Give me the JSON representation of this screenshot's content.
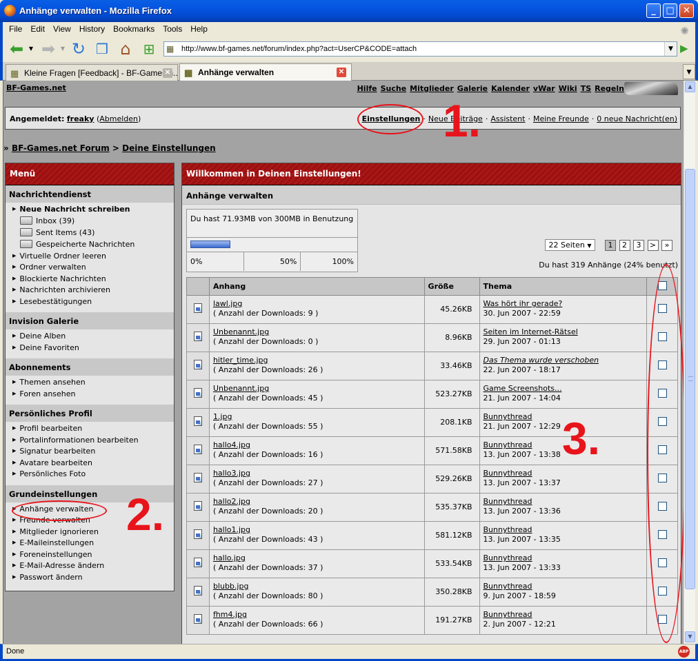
{
  "window": {
    "title": "Anhänge verwalten - Mozilla Firefox",
    "minimize": "_",
    "maximize": "□",
    "close": "✕"
  },
  "menubar": [
    "File",
    "Edit",
    "View",
    "History",
    "Bookmarks",
    "Tools",
    "Help"
  ],
  "navbar": {
    "url": "http://www.bf-games.net/forum/index.php?act=UserCP&CODE=attach"
  },
  "tabs": [
    {
      "label": "Kleine Fragen [Feedback] - BF-Games.n...",
      "active": false
    },
    {
      "label": "Anhänge verwalten",
      "active": true
    }
  ],
  "status": {
    "text": "Done",
    "abp": "ABP"
  },
  "forum": {
    "site_title": "BF-Games.net",
    "top_links": [
      "Hilfe",
      "Suche",
      "Mitglieder",
      "Galerie",
      "Kalender",
      "vWar",
      "Wiki",
      "TS",
      "Regeln"
    ],
    "user": {
      "logged_in_label": "Angemeldet:",
      "username": "freaky",
      "logout": "Abmelden"
    },
    "user_links": [
      "Einstellungen",
      "Neue Beiträge",
      "Assistent",
      "Meine Freunde",
      "0 neue Nachricht(en)"
    ],
    "breadcrumb": {
      "prefix": "»",
      "home": "BF-Games.net Forum",
      "sep": ">",
      "current": "Deine Einstellungen"
    }
  },
  "sidemenu": {
    "title": "Menü",
    "sections": [
      {
        "title": "Nachrichtendienst",
        "items": [
          {
            "label": "Neue Nachricht schreiben",
            "bold": true
          },
          {
            "label": "Inbox (39)",
            "folder": true
          },
          {
            "label": "Sent Items (43)",
            "folder": true
          },
          {
            "label": "Gespeicherte Nachrichten",
            "folder": true
          },
          {
            "label": "Virtuelle Ordner leeren"
          },
          {
            "label": "Ordner verwalten"
          },
          {
            "label": "Blockierte Nachrichten"
          },
          {
            "label": "Nachrichten archivieren"
          },
          {
            "label": "Lesebestätigungen"
          }
        ]
      },
      {
        "title": "Invision Galerie",
        "items": [
          {
            "label": "Deine Alben"
          },
          {
            "label": "Deine Favoriten"
          }
        ]
      },
      {
        "title": "Abonnements",
        "items": [
          {
            "label": "Themen ansehen"
          },
          {
            "label": "Foren ansehen"
          }
        ]
      },
      {
        "title": "Persönliches Profil",
        "items": [
          {
            "label": "Profil bearbeiten"
          },
          {
            "label": "Portalinformationen bearbeiten"
          },
          {
            "label": "Signatur bearbeiten"
          },
          {
            "label": "Avatare bearbeiten"
          },
          {
            "label": "Persönliches Foto"
          }
        ]
      },
      {
        "title": "Grundeinstellungen",
        "items": [
          {
            "label": "Anhänge verwalten"
          },
          {
            "label": "Freunde verwalten"
          },
          {
            "label": "Mitglieder ignorieren"
          },
          {
            "label": "E-Maileinstellungen"
          },
          {
            "label": "Foreneinstellungen"
          },
          {
            "label": "E-Mail-Adresse ändern"
          },
          {
            "label": "Passwort ändern"
          }
        ]
      }
    ]
  },
  "main": {
    "title": "Willkommen in Deinen Einstellungen!",
    "subtitle": "Anhänge verwalten",
    "quota": {
      "text": "Du hast 71.93MB von 300MB in Benutzung",
      "used_fraction": 0.24,
      "scale": [
        "0%",
        "50%",
        "100%"
      ]
    },
    "pager": {
      "pages_label": "22 Seiten",
      "pages": [
        "1",
        "2",
        "3"
      ],
      "current": "1",
      "next": ">",
      "last": "»"
    },
    "attachment_count": "Du hast 319 Anhänge (24% benutzt)",
    "columns": [
      "Anhang",
      "Größe",
      "Thema"
    ],
    "rows": [
      {
        "file": "lawl.jpg",
        "downloads": "( Anzahl der Downloads: 9 )",
        "size": "45.26KB",
        "topic": "Was hört ihr gerade?",
        "date": "30. Jun 2007 - 22:59",
        "moved": false
      },
      {
        "file": "Unbenannt.jpg",
        "downloads": "( Anzahl der Downloads: 0 )",
        "size": "8.96KB",
        "topic": "Seiten im Internet-Rätsel",
        "date": "29. Jun 2007 - 01:13",
        "moved": false
      },
      {
        "file": "hitler_time.jpg",
        "downloads": "( Anzahl der Downloads: 26 )",
        "size": "33.46KB",
        "topic": "Das Thema wurde verschoben",
        "date": "22. Jun 2007 - 18:17",
        "moved": true
      },
      {
        "file": "Unbenannt.jpg",
        "downloads": "( Anzahl der Downloads: 45 )",
        "size": "523.27KB",
        "topic": "Game Screenshots...",
        "date": "21. Jun 2007 - 14:04",
        "moved": false
      },
      {
        "file": "1.jpg",
        "downloads": "( Anzahl der Downloads: 55 )",
        "size": "208.1KB",
        "topic": "Bunnythread",
        "date": "21. Jun 2007 - 12:29",
        "moved": false
      },
      {
        "file": "hallo4.jpg",
        "downloads": "( Anzahl der Downloads: 16 )",
        "size": "571.58KB",
        "topic": "Bunnythread",
        "date": "13. Jun 2007 - 13:38",
        "moved": false
      },
      {
        "file": "hallo3.jpg",
        "downloads": "( Anzahl der Downloads: 27 )",
        "size": "529.26KB",
        "topic": "Bunnythread",
        "date": "13. Jun 2007 - 13:37",
        "moved": false
      },
      {
        "file": "hallo2.jpg",
        "downloads": "( Anzahl der Downloads: 20 )",
        "size": "535.37KB",
        "topic": "Bunnythread",
        "date": "13. Jun 2007 - 13:36",
        "moved": false
      },
      {
        "file": "hallo1.jpg",
        "downloads": "( Anzahl der Downloads: 43 )",
        "size": "581.12KB",
        "topic": "Bunnythread",
        "date": "13. Jun 2007 - 13:35",
        "moved": false
      },
      {
        "file": "hallo.jpg",
        "downloads": "( Anzahl der Downloads: 37 )",
        "size": "533.54KB",
        "topic": "Bunnythread",
        "date": "13. Jun 2007 - 13:33",
        "moved": false
      },
      {
        "file": "blubb.jpg",
        "downloads": "( Anzahl der Downloads: 80 )",
        "size": "350.28KB",
        "topic": "Bunnythread",
        "date": "9. Jun 2007 - 18:59",
        "moved": false
      },
      {
        "file": "fhm4.jpg",
        "downloads": "( Anzahl der Downloads: 66 )",
        "size": "191.27KB",
        "topic": "Bunnythread",
        "date": "2. Jun 2007 - 12:21",
        "moved": false
      }
    ]
  },
  "annotations": {
    "one": "1.",
    "two": "2.",
    "three": "3.",
    "color": "#e8141b"
  },
  "colors": {
    "maroon": "#9b0f0f",
    "xp_blue": "#0347c9",
    "content_gray": "#a3a3a3"
  }
}
